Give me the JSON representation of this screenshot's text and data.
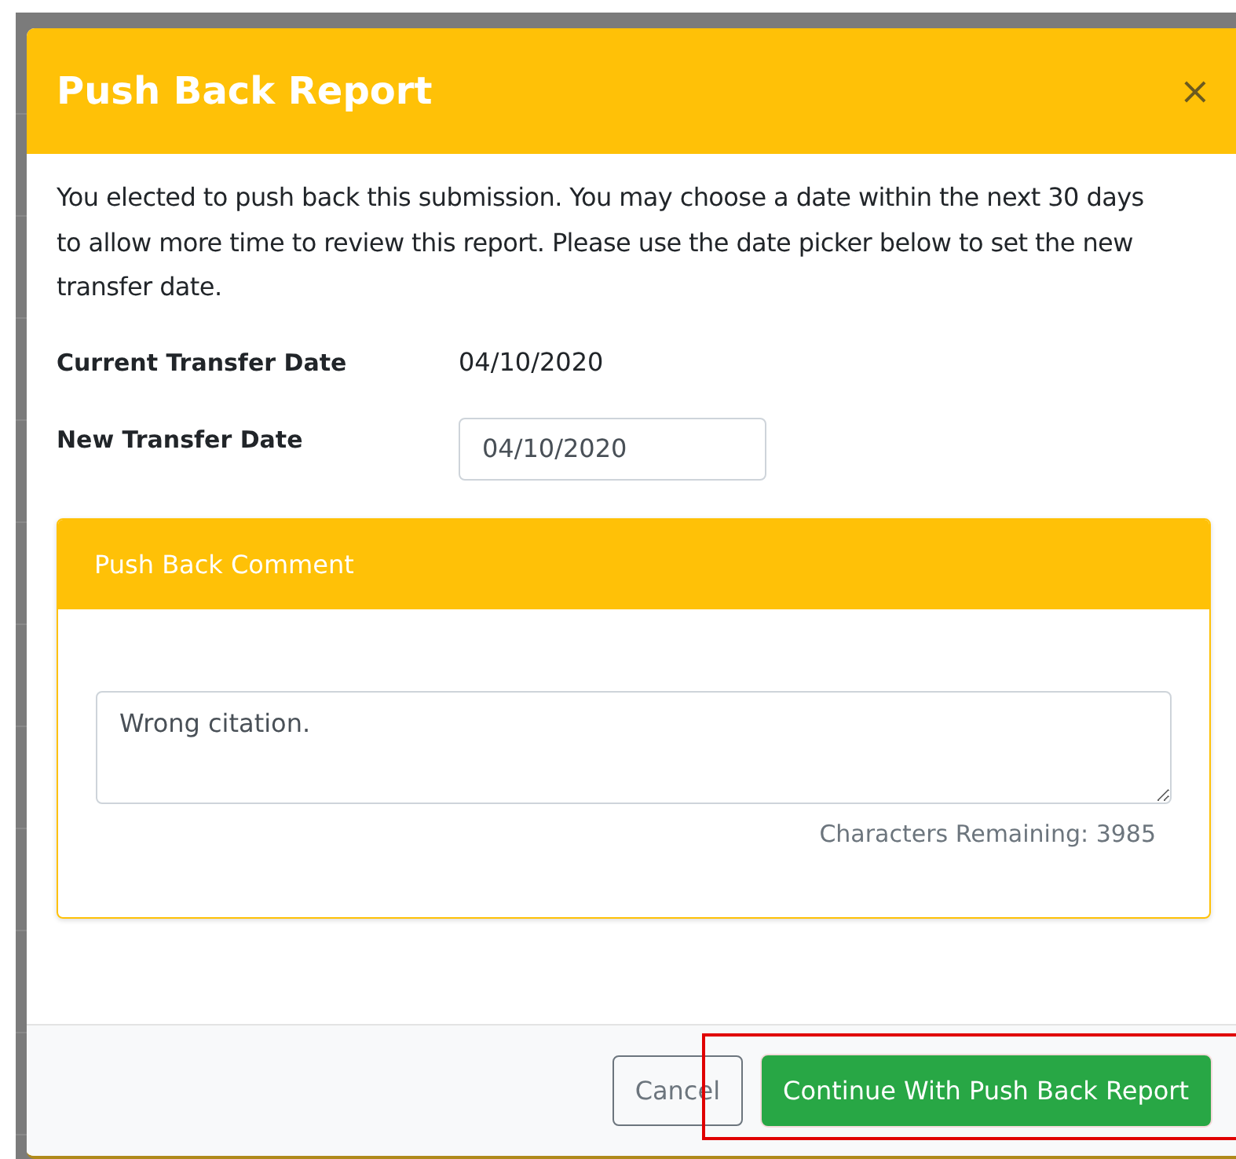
{
  "modal": {
    "title": "Push Back Report",
    "close": "×"
  },
  "intro": "You elected to push back this submission. You may choose a date within the next 30 days to allow more time to review this report. Please use the date picker below to set the new transfer date.",
  "fields": [
    {
      "kind": "text",
      "label": "Current Transfer Date",
      "value": "04/10/2020"
    },
    {
      "kind": "input",
      "label": "New Transfer Date",
      "value": "04/10/2020"
    }
  ],
  "comment_card": {
    "title": "Push Back Comment",
    "value": "Wrong citation.",
    "characters_remaining": "Characters Remaining: 3985"
  },
  "buttons": [
    {
      "kind": "secondary",
      "label": "Cancel",
      "highlighted": false
    },
    {
      "kind": "primary",
      "label": "Continue With Push Back Report",
      "highlighted": true
    }
  ]
}
